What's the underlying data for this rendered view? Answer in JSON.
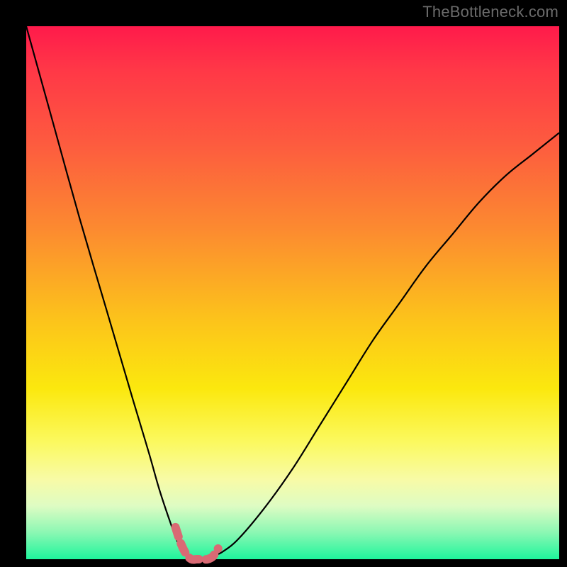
{
  "watermark": "TheBottleneck.com",
  "colors": {
    "frame": "#000000",
    "curve": "#000000",
    "highlight": "#d96a74",
    "gradient_stops": [
      "#ff1a4b",
      "#ff3747",
      "#fd5b3f",
      "#fc8a30",
      "#fcc31b",
      "#fbe80e",
      "#fbf95f",
      "#f8fba6",
      "#defcc3",
      "#8bf7b3",
      "#1ef59c"
    ]
  },
  "chart_data": {
    "type": "line",
    "title": "",
    "xlabel": "",
    "ylabel": "",
    "xlim": [
      0,
      100
    ],
    "ylim": [
      0,
      100
    ],
    "series": [
      {
        "name": "bottleneck-curve",
        "x": [
          0,
          5,
          10,
          15,
          20,
          23,
          25,
          27,
          28.5,
          30,
          31,
          32,
          33,
          34,
          35,
          37,
          40,
          45,
          50,
          55,
          60,
          65,
          70,
          75,
          80,
          85,
          90,
          95,
          100
        ],
        "values": [
          100,
          82,
          64,
          47,
          30,
          20,
          13,
          7,
          3,
          1,
          0,
          0,
          0,
          0,
          0.5,
          1.5,
          4,
          10,
          17,
          25,
          33,
          41,
          48,
          55,
          61,
          67,
          72,
          76,
          80
        ]
      },
      {
        "name": "highlight-segment",
        "x": [
          28,
          29,
          30,
          31,
          32,
          33,
          34,
          35,
          36
        ],
        "values": [
          6,
          3,
          1,
          0,
          0,
          0,
          0,
          0.5,
          2
        ]
      }
    ],
    "annotations": []
  }
}
